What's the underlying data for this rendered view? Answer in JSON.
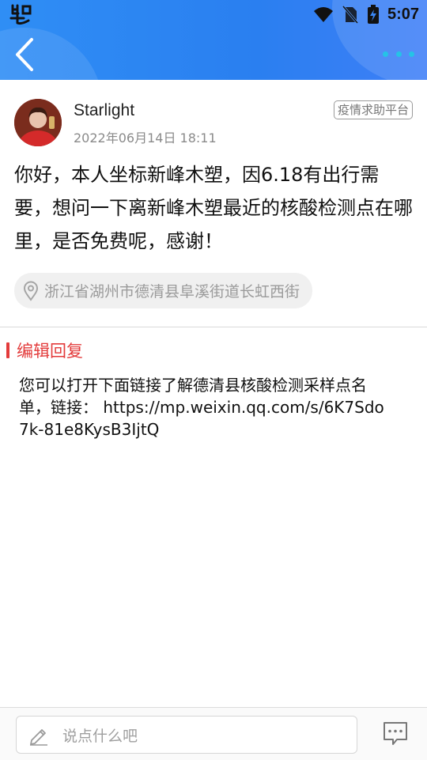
{
  "status_bar": {
    "time": "5:07",
    "icons": [
      "app-logo-icon",
      "wifi-icon",
      "no-sim-icon",
      "battery-charging-icon"
    ]
  },
  "header": {
    "back_icon": "chevron-left-icon",
    "more_icon": "more-dots-icon",
    "colors": {
      "gradient_start": "#2f8ef5",
      "gradient_end": "#3f7ff7",
      "more_dots": "#25c3e6"
    }
  },
  "post": {
    "author": "Starlight",
    "datetime": "2022年06月14日 18:11",
    "tag": "疫情求助平台",
    "content": "你好，本人坐标新峰木塑，因6.18有出行需要，想问一下离新峰木塑最近的核酸检测点在哪里，是否免费呢，感谢！",
    "location": "浙江省湖州市德清县阜溪街道长虹西街",
    "location_icon": "location-pin-icon"
  },
  "reply": {
    "title": "编辑回复",
    "content": "您可以打开下面链接了解德清县核酸检测采样点名单，链接： https://mp.weixin.qq.com/s/6K7Sdo7k-81e8KysB3IjtQ",
    "accent_color": "#e33b3b"
  },
  "bottom_bar": {
    "input_placeholder": "说点什么吧",
    "input_icon": "pencil-icon",
    "chat_icon": "comment-icon"
  }
}
